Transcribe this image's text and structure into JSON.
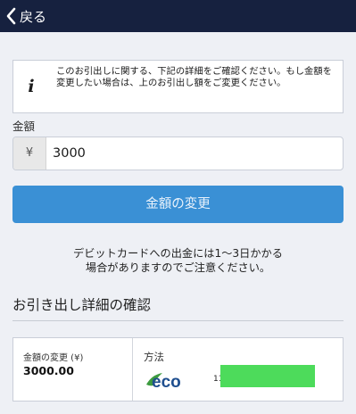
{
  "nav": {
    "back_label": "戻る"
  },
  "info": {
    "icon": "info-icon",
    "icon_glyph": "i",
    "message": "このお引出しに関する、下記の詳細をご確認ください。もし金額を変更したい場合は、上のお引出し額をご変更ください。"
  },
  "amount": {
    "label": "金額",
    "currency_symbol": "¥",
    "value": "3000"
  },
  "change_button": {
    "label": "金額の変更"
  },
  "notice": {
    "line1": "デビットカードへの出金には1〜3日かかる",
    "line2": "場合がありますのでご注意ください。"
  },
  "details": {
    "title": "お引き出し詳細の確認",
    "amount_label": "金額の変更 (¥)",
    "amount_value": "3000.00",
    "method_label": "方法",
    "method_logo": "eco",
    "account_prefix": "11"
  },
  "colors": {
    "topbar": "#16213f",
    "button": "#3a90d5",
    "eco_green": "#3d9b3f",
    "eco_blue": "#1f4f8f",
    "redaction": "#4ddb5b"
  }
}
